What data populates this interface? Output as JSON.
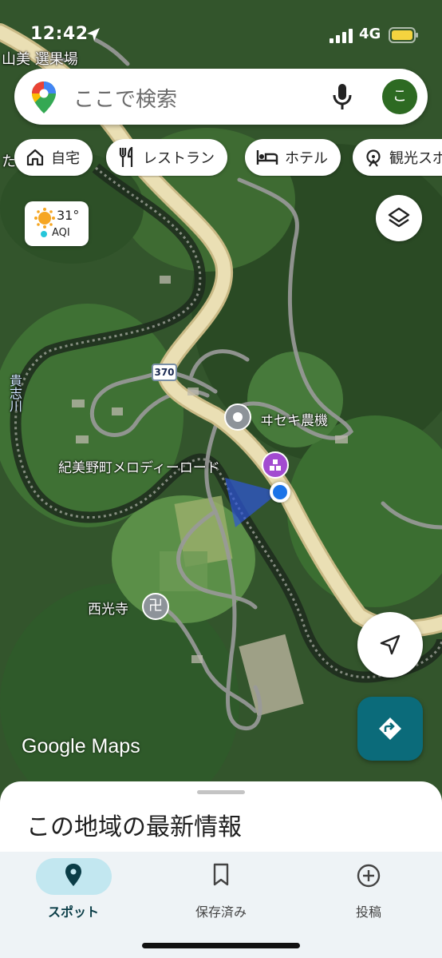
{
  "status_bar": {
    "time": "12:42",
    "network": "4G"
  },
  "search": {
    "placeholder": "ここで検索",
    "avatar_letter": "こ"
  },
  "chips": [
    {
      "label": "自宅",
      "icon": "home-icon"
    },
    {
      "label": "レストラン",
      "icon": "restaurant-icon"
    },
    {
      "label": "ホテル",
      "icon": "hotel-icon"
    },
    {
      "label": "観光スポ",
      "icon": "attraction-icon"
    }
  ],
  "weather": {
    "temp": "31°",
    "aqi_label": "AQI"
  },
  "map": {
    "labels": {
      "top_left": "山美 選果場",
      "river": "貴志川",
      "road_shield": "370",
      "iseki": "ヰセキ農機",
      "melody_road": "紀美野町メロディーロード",
      "temple": "西光寺",
      "left_edge": "た"
    },
    "logo": "Google Maps"
  },
  "sheet": {
    "title": "この地域の最新情報"
  },
  "nav": [
    {
      "label": "スポット",
      "icon": "explore-pin-icon",
      "active": true
    },
    {
      "label": "保存済み",
      "icon": "bookmark-icon",
      "active": false
    },
    {
      "label": "投稿",
      "icon": "add-circle-icon",
      "active": false
    }
  ],
  "colors": {
    "accent": "#0b6b7a",
    "active_pill": "#c2e7f0",
    "location_dot": "#1a73e8",
    "road": "#e5d5a0"
  }
}
